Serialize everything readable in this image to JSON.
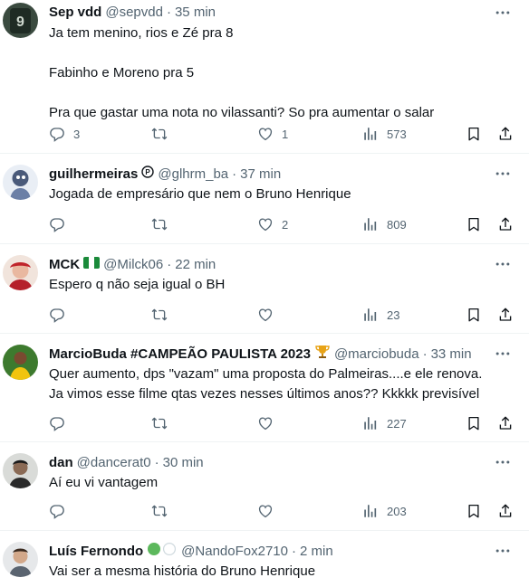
{
  "tweets": [
    {
      "name": "Sep vdd",
      "handle": "@sepvdd",
      "time": "35 min",
      "text": "Ja tem menino, rios e Zé pra 8\n\nFabinho e Moreno pra 5\n\nPra que gastar uma nota no vilassanti? So pra aumentar o salar",
      "replies": "3",
      "retweets": "",
      "likes": "1",
      "views": "573"
    },
    {
      "name": "guilhermeiras",
      "handle": "@glhrm_ba",
      "time": "37 min",
      "text": "Jogada de empresário que nem o Bruno Henrique",
      "replies": "",
      "retweets": "",
      "likes": "2",
      "views": "809"
    },
    {
      "name": "MCK",
      "handle": "@Milck06",
      "time": "22 min",
      "text": "Espero q não seja igual o BH",
      "replies": "",
      "retweets": "",
      "likes": "",
      "views": "23"
    },
    {
      "name": "MarcioBuda #CAMPEÃO PAULISTA 2023",
      "handle": "@marciobuda",
      "time": "33 min",
      "text": "Quer aumento, dps \"vazam\" uma proposta do Palmeiras....e ele renova.\nJa vimos esse filme qtas vezes nesses últimos anos?? Kkkkk previsível",
      "replies": "",
      "retweets": "",
      "likes": "",
      "views": "227"
    },
    {
      "name": "dan",
      "handle": "@dancerat0",
      "time": "30 min",
      "text": "Aí eu vi vantagem",
      "replies": "",
      "retweets": "",
      "likes": "",
      "views": "203"
    },
    {
      "name": "Luís Fernondo",
      "handle": "@NandoFox2710",
      "time": "2 min",
      "text": "Vai ser a mesma história do Bruno Henrique"
    }
  ],
  "colors": {
    "text": "#0f1419",
    "muted": "#536471",
    "divider": "#eff3f4",
    "badge_green": "#5cb85c"
  },
  "icons": {
    "more": "more-horizontal-icon",
    "reply": "reply-icon",
    "retweet": "retweet-icon",
    "like": "heart-icon",
    "views": "views-icon",
    "bookmark": "bookmark-icon",
    "share": "share-icon",
    "badge_circle": "circle-badge-icon",
    "flag": "nigeria-flag-icon",
    "trophy": "trophy-icon"
  }
}
